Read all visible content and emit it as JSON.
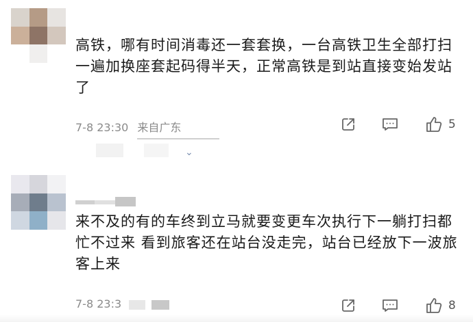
{
  "comments": [
    {
      "text": "高铁，哪有时间消毒还一套套换，一台高铁卫生全部打扫一遍加换座套起码得半天，正常高铁是到站直接变始发站了",
      "time": "7-8 23:30",
      "location": "来自广东",
      "likes": "5"
    },
    {
      "text": "来不及的有的车终到立马就要变更车次执行下一躺打扫都忙不过来 看到旅客还在站台没走完，站台已经放下一波旅客上来",
      "time": "7-8 23:3",
      "location": "",
      "likes": "8"
    }
  ],
  "icons": {
    "share": "share-icon",
    "reply": "comment-icon",
    "like": "thumbs-up-icon",
    "expand": "chevron-down-icon"
  },
  "colors": {
    "text": "#1a1a1a",
    "meta": "#8a8a8a",
    "icon": "#666666"
  }
}
